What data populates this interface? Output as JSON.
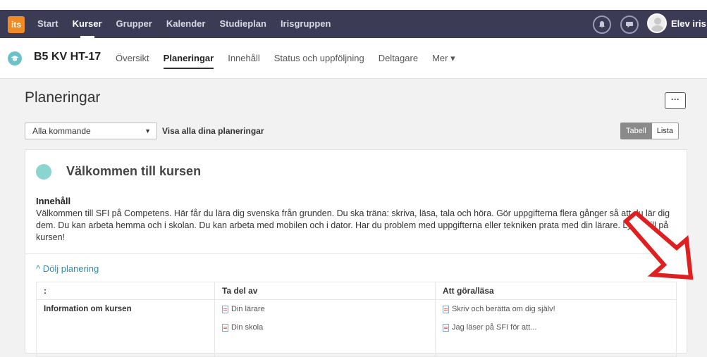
{
  "topnav": {
    "logo": "its",
    "items": [
      "Start",
      "Kurser",
      "Grupper",
      "Kalender",
      "Studieplan",
      "Irisgruppen"
    ],
    "active_index": 1,
    "user_name": "Elev iris",
    "icons": [
      "bell-icon",
      "chat-icon"
    ]
  },
  "course": {
    "title": "B5 KV HT-17",
    "tabs": [
      "Översikt",
      "Planeringar",
      "Innehåll",
      "Status och uppföljning",
      "Deltagare",
      "Mer ▾"
    ],
    "active_index": 1
  },
  "main": {
    "title": "Planeringar",
    "more_label": "···",
    "filter_value": "Alla kommande",
    "show_all_label": "Visa alla dina planeringar",
    "view_toggle": [
      "Tabell",
      "Lista"
    ]
  },
  "planning": {
    "title": "Välkommen till kursen",
    "content_heading": "Innehåll",
    "content_text": "Välkommen till SFI på Competens. Här får du lära dig svenska från grunden. Du ska träna: skriva, läsa, tala och höra. Gör uppgifterna flera gånger så att du lär dig dem. Du kan arbeta hemma och i skolan. Du kan arbeta med mobilen och i dator. Har du problem med uppgifterna eller tekniken prata med din lärare. Lycka till på kursen!",
    "toggle_label": "^ Dölj planering",
    "table": {
      "headers": [
        ":",
        "Ta del av",
        "Att göra/läsa"
      ],
      "row_label": "Information om kursen",
      "ta_del_av": [
        "Din lärare",
        "Din skola"
      ],
      "att_gora": [
        "Skriv och berätta om dig själv!",
        "Jag läser på SFI för att..."
      ]
    }
  },
  "colors": {
    "topbar": "#3b3b55",
    "accent": "#6fc1c9",
    "link": "#2f8ca8",
    "arrow": "#e02020"
  }
}
